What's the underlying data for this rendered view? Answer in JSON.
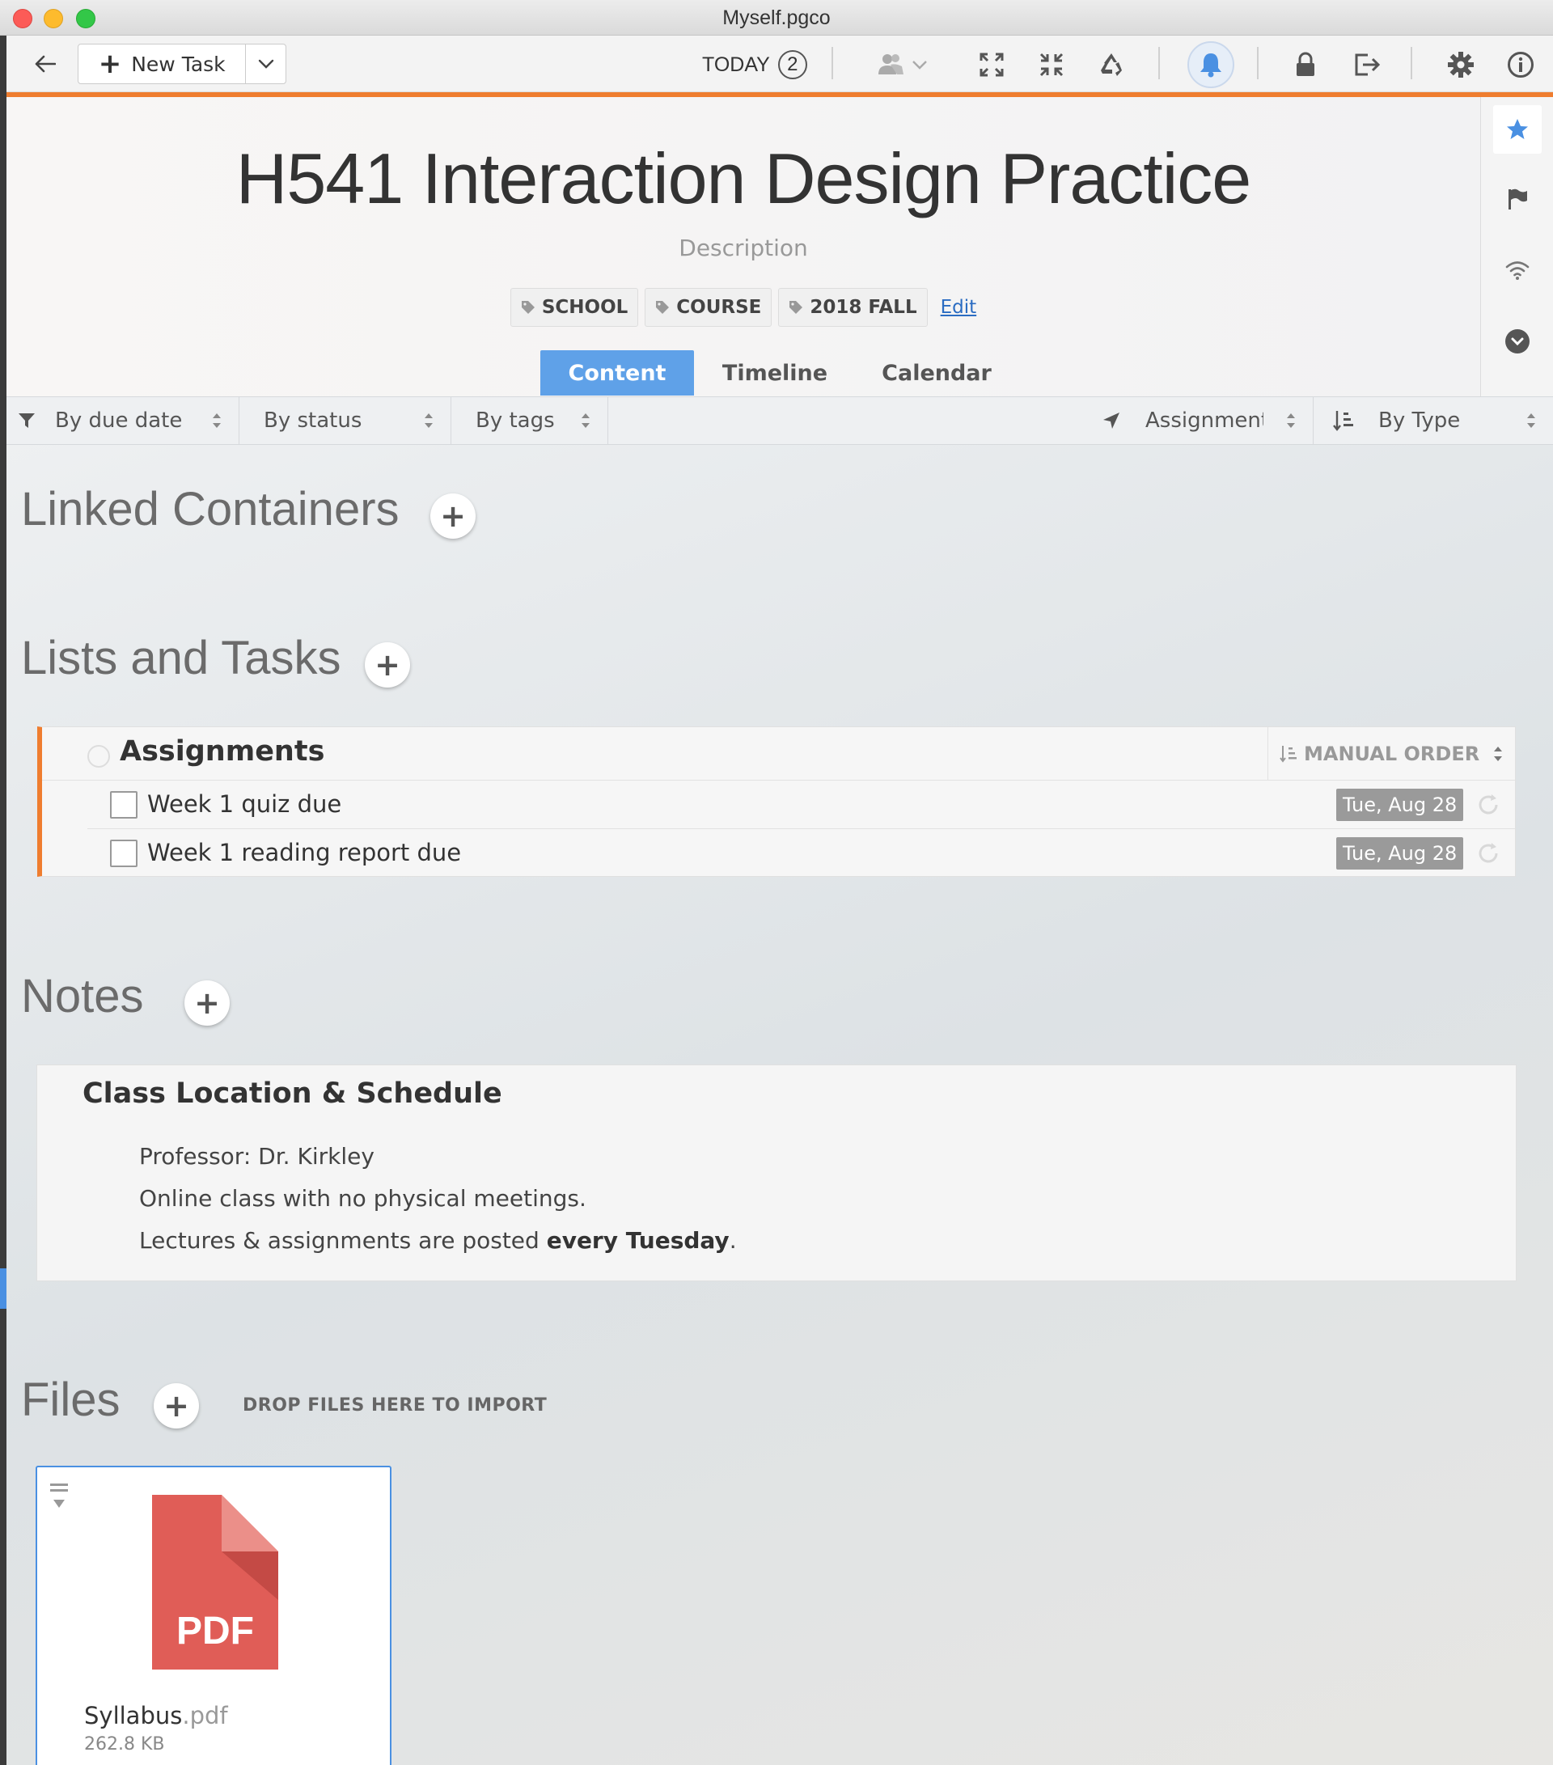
{
  "window": {
    "title": "Myself.pgco"
  },
  "toolbar": {
    "new_task_label": "New Task",
    "today_label": "TODAY",
    "today_count": "2"
  },
  "header": {
    "title": "H541 Interaction Design Practice",
    "description": "Description",
    "tags": [
      "SCHOOL",
      "COURSE",
      "2018 FALL"
    ],
    "edit_label": "Edit",
    "tabs": [
      {
        "label": "Content",
        "active": true
      },
      {
        "label": "Timeline",
        "active": false
      },
      {
        "label": "Calendar",
        "active": false
      }
    ]
  },
  "filters": {
    "due_date": "By due date",
    "status": "By status",
    "tags": "By tags",
    "assignment": "Assignment",
    "type": "By Type"
  },
  "sections": {
    "linked_containers": "Linked Containers",
    "lists_and_tasks": "Lists and Tasks",
    "notes": "Notes",
    "files": "Files",
    "drop_hint": "DROP FILES HERE TO IMPORT"
  },
  "task_list": {
    "title": "Assignments",
    "order_label": "MANUAL ORDER",
    "tasks": [
      {
        "label": "Week 1 quiz due",
        "date": "Tue, Aug 28"
      },
      {
        "label": "Week 1 reading report due",
        "date": "Tue, Aug 28"
      }
    ]
  },
  "note": {
    "title": "Class Location & Schedule",
    "line1": "Professor: Dr. Kirkley",
    "line2": "Online class with no physical meetings.",
    "line3_prefix": "Lectures & assignments are posted ",
    "line3_bold": "every Tuesday",
    "line3_suffix": "."
  },
  "file": {
    "icon_label": "PDF",
    "name_base": "Syllabus",
    "name_ext": ".pdf",
    "size": "262.8 KB"
  },
  "colors": {
    "accent_orange": "#ef7d2f",
    "tab_active": "#5fa1e8",
    "pdf_red": "#e05d57",
    "link_blue": "#2a6cc2"
  }
}
